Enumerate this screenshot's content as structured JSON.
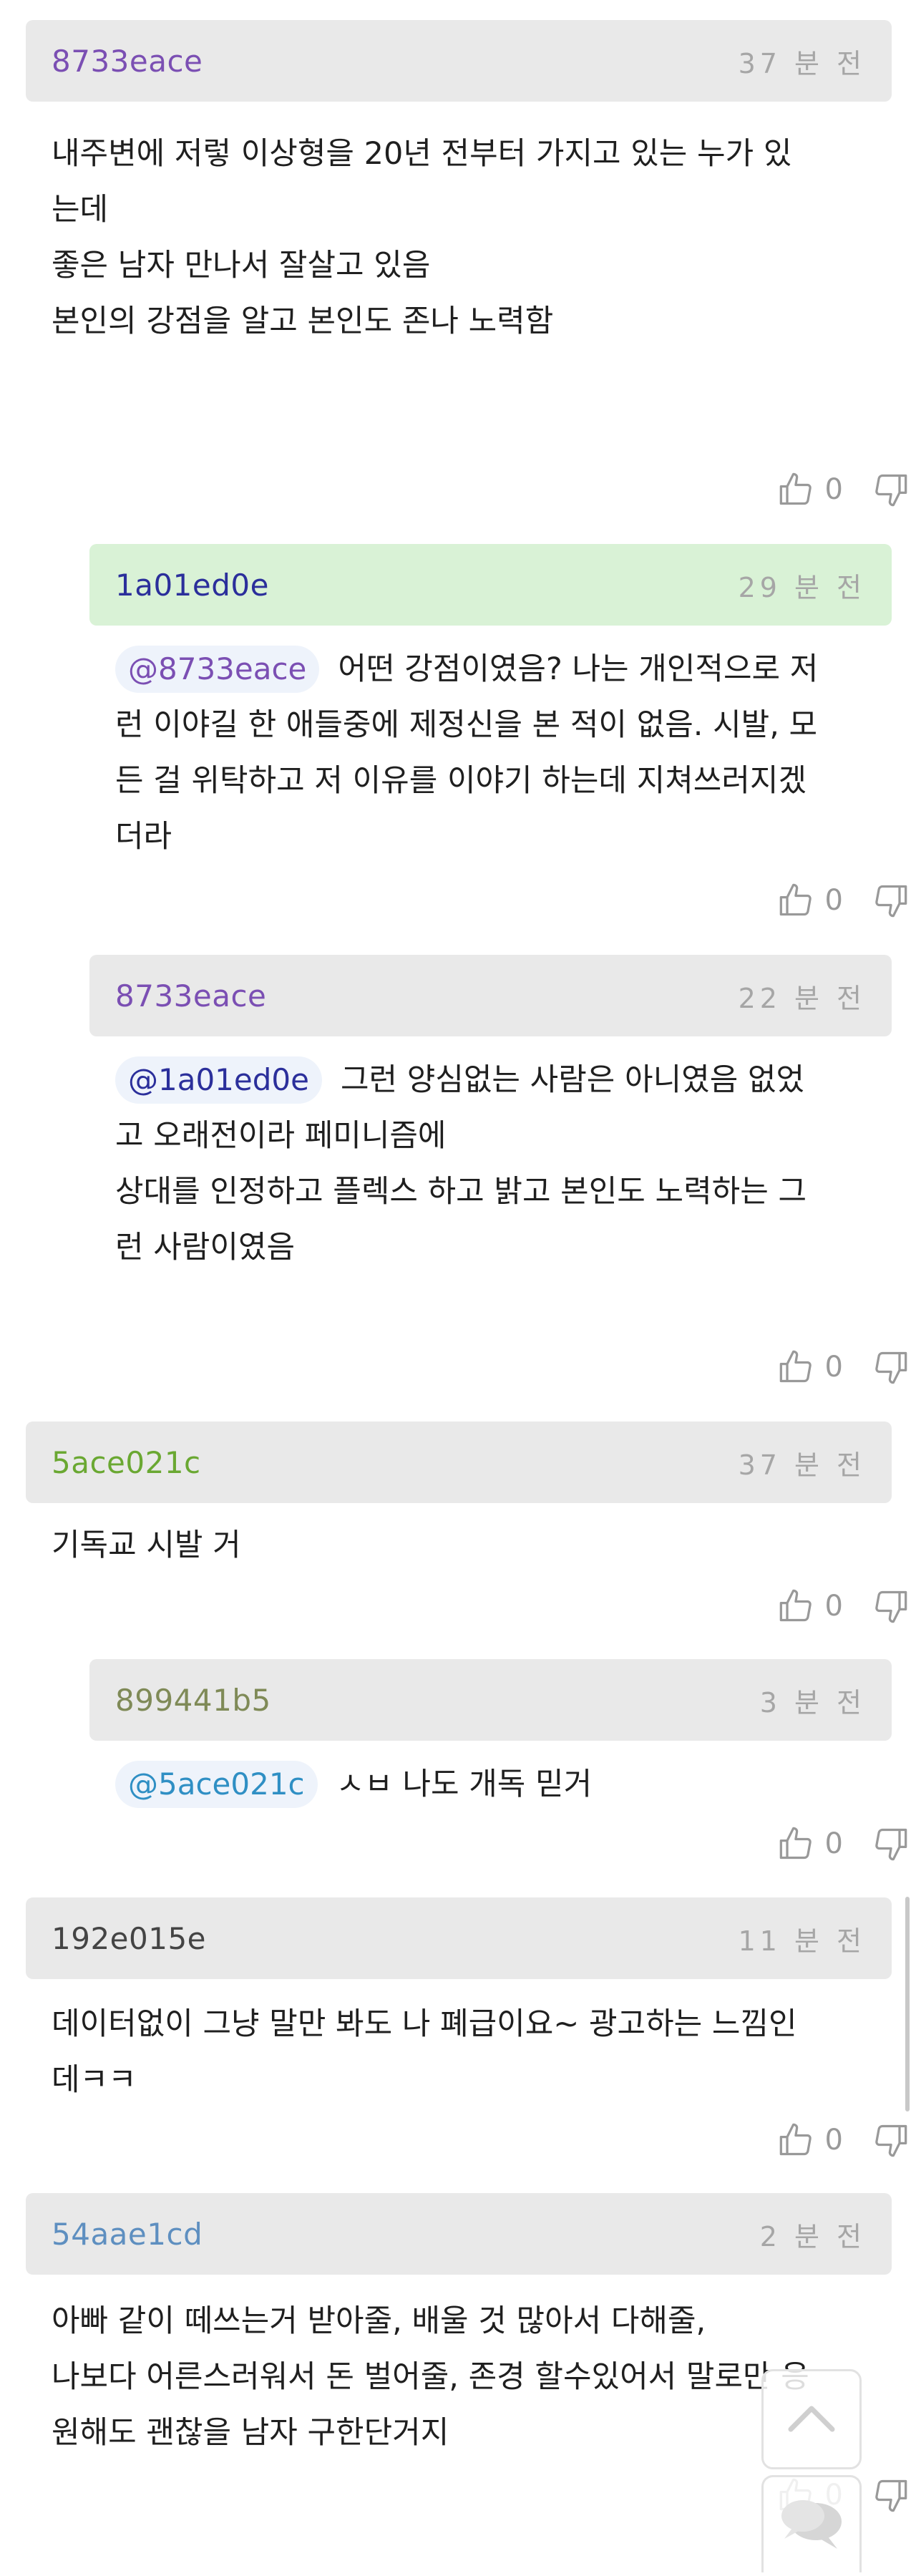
{
  "comments": [
    {
      "author": "8733eace",
      "author_color": "#7b4fb3",
      "header_bg": "#e9e9e9",
      "time": "37 분 전",
      "lines": [
        "내주변에 저렇 이상형을 20년 전부터 가지고 있는 누가 있",
        "는데",
        "좋은 남자 만나서 잘살고 있음",
        "본인의 강점을 알고 본인도 존나 노력함"
      ],
      "likes": "0"
    },
    {
      "author": "1a01ed0e",
      "author_color": "#2b2f9b",
      "header_bg": "#d9f2d6",
      "time": "29 분 전",
      "mention": "@8733eace",
      "mention_color": "#7b4fb3",
      "mention_bg": "#eef3fb",
      "lines": [
        "어떤 강점이였음? 나는 개인적으로 저",
        "런 이야길 한 애들중에 제정신을 본 적이 없음. 시발, 모",
        "든 걸 위탁하고 저 이유를 이야기 하는데 지쳐쓰러지겠",
        "더라"
      ],
      "likes": "0"
    },
    {
      "author": "8733eace",
      "author_color": "#7b4fb3",
      "header_bg": "#e9e9e9",
      "time": "22 분 전",
      "mention": "@1a01ed0e",
      "mention_color": "#2b2f9b",
      "mention_bg": "#eef3fb",
      "lines": [
        "그런 양심없는 사람은 아니였음 없었",
        "고 오래전이라 페미니즘에",
        "상대를 인정하고 플렉스 하고 밝고 본인도 노력하는 그",
        "런 사람이였음"
      ],
      "likes": "0"
    },
    {
      "author": "5ace021c",
      "author_color": "#6aa832",
      "header_bg": "#e9e9e9",
      "time": "37 분 전",
      "lines": [
        "기독교 시발 거"
      ],
      "likes": "0"
    },
    {
      "author": "899441b5",
      "author_color": "#7f8a57",
      "header_bg": "#e9e9e9",
      "time": "3 분 전",
      "mention": "@5ace021c",
      "mention_color": "#2f8fc4",
      "mention_bg": "#eef3fb",
      "lines": [
        "ㅅㅂ 나도 개독 믿거"
      ],
      "likes": "0"
    },
    {
      "author": "192e015e",
      "author_color": "#444444",
      "header_bg": "#e9e9e9",
      "time": "11 분 전",
      "lines": [
        "데이터없이 그냥 말만 봐도 나 폐급이요~ 광고하는 느낌인",
        "데ㅋㅋ"
      ],
      "likes": "0"
    },
    {
      "author": "54aae1cd",
      "author_color": "#5e8fc0",
      "header_bg": "#e9e9e9",
      "time": "2 분 전",
      "lines": [
        "아빠 같이 떼쓰는거 받아줄, 배울 것 많아서 다해줄,",
        "나보다 어른스러워서 돈 벌어줄, 존경 할수있어서 말로만 응",
        "원해도 괜찮을 남자 구한단거지"
      ],
      "likes": "0"
    }
  ],
  "icons": {
    "like": "thumbs-up-icon",
    "dislike": "thumbs-down-icon",
    "scroll_top": "chevron-up-icon",
    "chat": "chat-bubbles-icon"
  }
}
